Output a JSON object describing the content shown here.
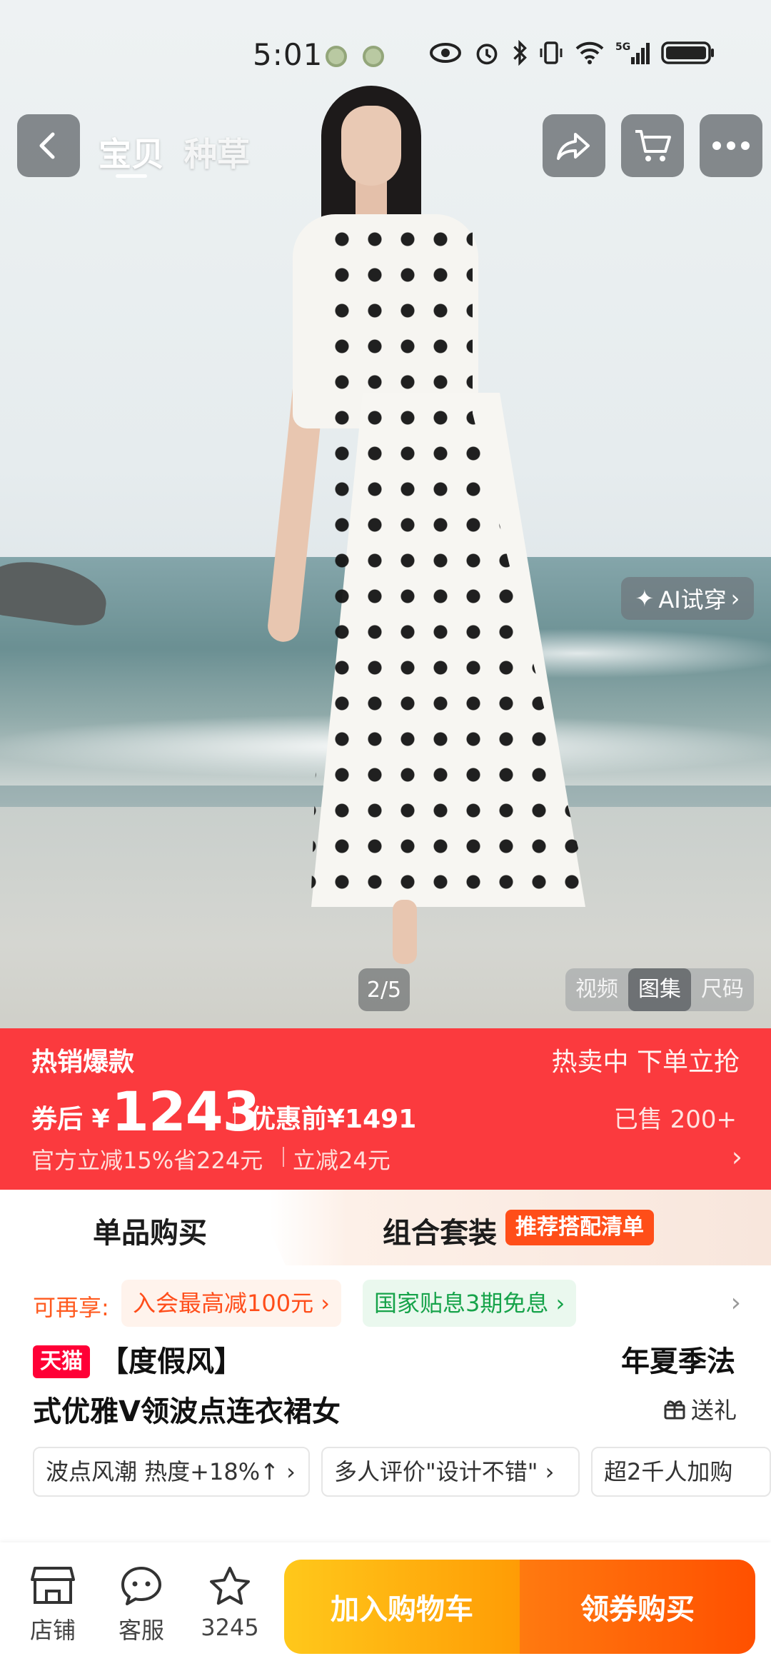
{
  "status_bar": {
    "time": "5:01",
    "icons": [
      "eye-icon",
      "alarm-icon",
      "bluetooth-icon",
      "vibrate-icon",
      "wifi-icon",
      "5g-signal-icon",
      "battery-icon"
    ]
  },
  "top_bar": {
    "tabs": [
      "宝贝",
      "种草"
    ]
  },
  "gallery": {
    "ai_try_on": "AI试穿",
    "counter": "2/5",
    "media_tabs": [
      "视频",
      "图集",
      "尺码"
    ]
  },
  "price_banner": {
    "hot_label": "热销爆款",
    "status": "热卖中 下单立抢",
    "price_prefix": "券后 ¥",
    "price": "1243",
    "original": "优惠前¥1491",
    "sold": "已售 200+",
    "deal1": "官方立减15%省224元",
    "deal2": "立减24元",
    "chevron": "›"
  },
  "purchase_mode": {
    "single": "单品购买",
    "combo": "组合套装",
    "badge": "推荐搭配清单"
  },
  "benefits": {
    "label": "可再享:",
    "member": "入会最高减100元 ›",
    "installment": "国家贴息3期免息 ›",
    "chevron": "›"
  },
  "product": {
    "platform": "天猫",
    "title_line1_left": "【度假风】",
    "title_line1_right": "年夏季法",
    "title_line2": "式优雅V领波点连衣裙女",
    "gift": "送礼"
  },
  "tags": [
    "波点风潮 热度+18%↑ ›",
    "多人评价\"设计不错\" ›",
    "超2千人加购"
  ],
  "bottom_bar": {
    "store": "店铺",
    "service": "客服",
    "favorites": "3245",
    "add_to_cart": "加入购物车",
    "buy": "领券购买"
  },
  "colors": {
    "brand_red": "#fb3a3e",
    "cart_orange": "#ffb000",
    "buy_orange": "#ff5000",
    "tmall_red": "#ff0036"
  }
}
